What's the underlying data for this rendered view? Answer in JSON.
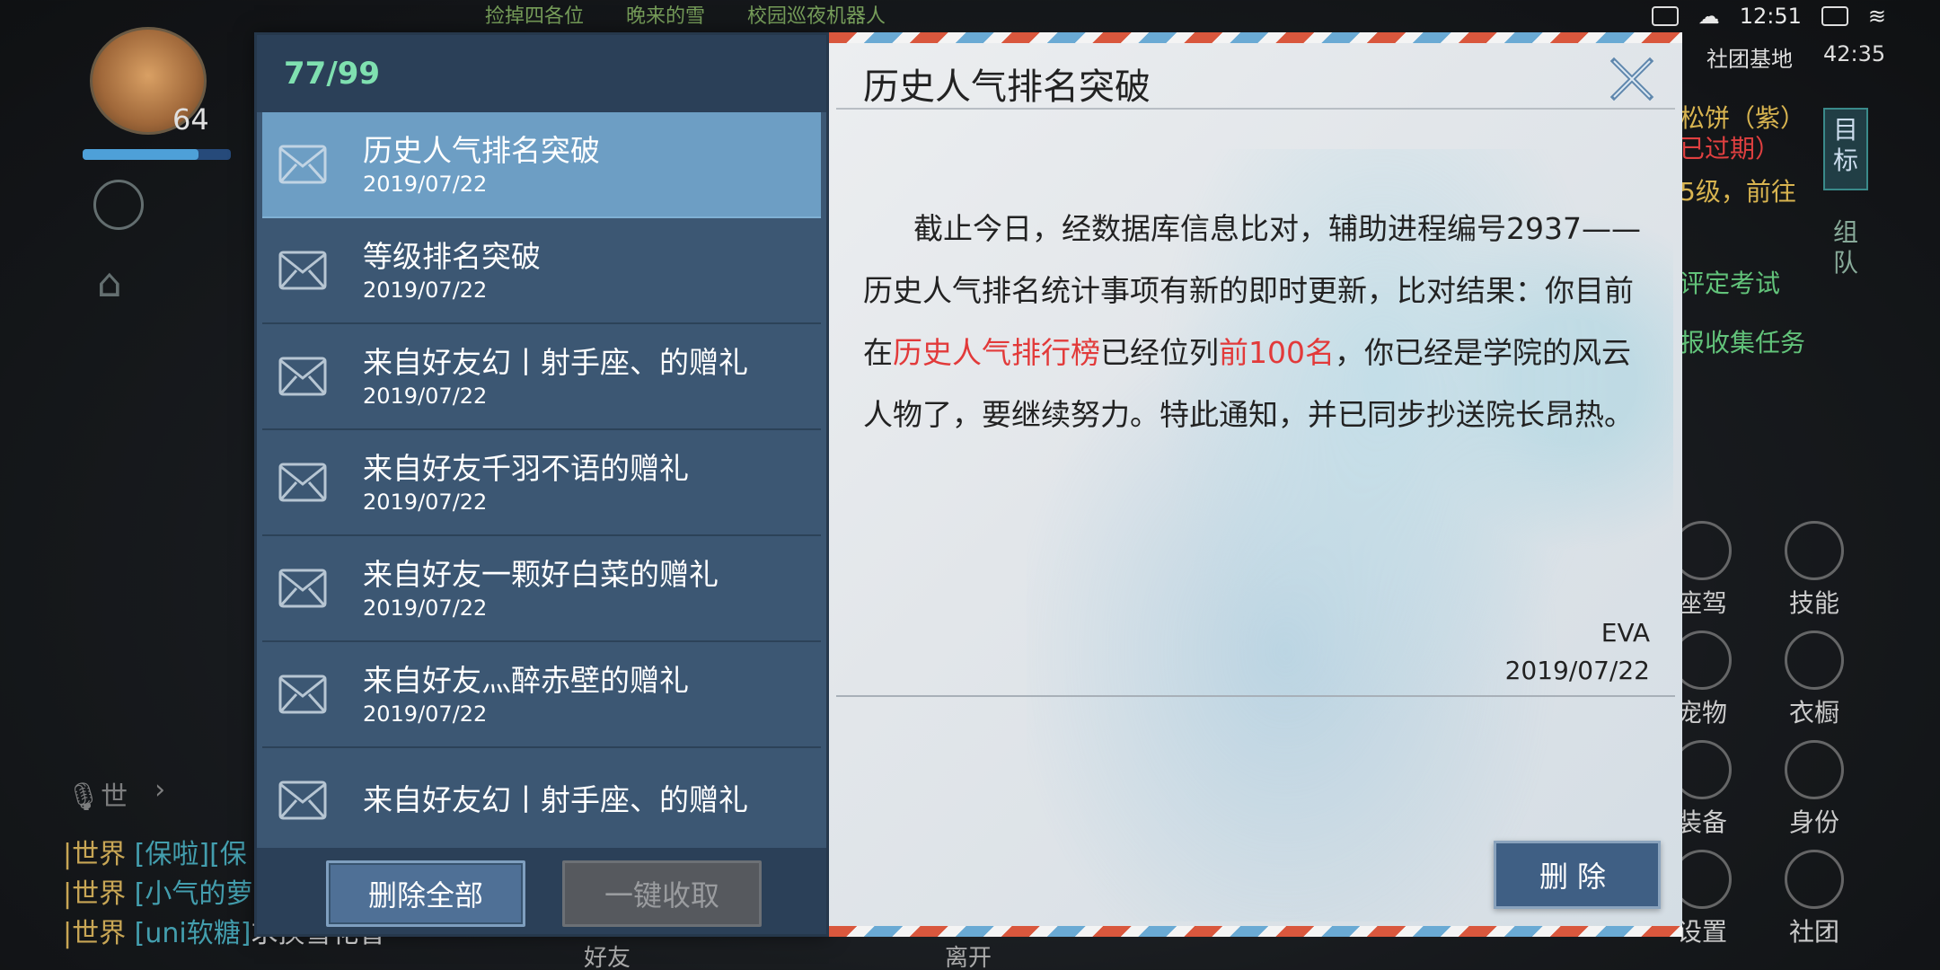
{
  "status_bar": {
    "time": "12:51"
  },
  "player": {
    "level": "64",
    "hp_fraction": 0.78
  },
  "hud": {
    "top_notices": [
      "捡掉四各位",
      "晚来的雪",
      "校园巡夜机器人"
    ],
    "right": {
      "timer": "42:35",
      "location": "社团基地",
      "quests": [
        "松饼（紫）",
        "已过期）",
        "5级，前往",
        "评定考试",
        "报收集任务"
      ],
      "tab_target": "目标",
      "tab_team": "组队",
      "buttons": [
        "座驾",
        "技能",
        "宠物",
        "衣橱",
        "装备",
        "身份",
        "设置",
        "社团"
      ]
    },
    "mic_label": "世",
    "chat": [
      {
        "channel": "|世界",
        "name": "[保啦]",
        "text": "[保"
      },
      {
        "channel": "|世界",
        "name": "[小气的萝",
        "text": ""
      },
      {
        "channel": "|世界",
        "name": "[uni软糖]",
        "text": "求换雪花香"
      }
    ],
    "bottom_labels": [
      "好友",
      "离开"
    ]
  },
  "mail": {
    "count": "77/99",
    "items": [
      {
        "title": "历史人气排名突破",
        "date": "2019/07/22",
        "active": true
      },
      {
        "title": "等级排名突破",
        "date": "2019/07/22"
      },
      {
        "title": "来自好友幻丨射手座、的赠礼",
        "date": "2019/07/22"
      },
      {
        "title": "来自好友千羽不语的赠礼",
        "date": "2019/07/22"
      },
      {
        "title": "来自好友一颗好白菜的赠礼",
        "date": "2019/07/22"
      },
      {
        "title": "来自好友灬醉赤壁的赠礼",
        "date": "2019/07/22"
      },
      {
        "title": "来自好友幻丨射手座、的赠礼",
        "date": ""
      }
    ],
    "delete_all_label": "删除全部",
    "collect_all_label": "一键收取",
    "detail": {
      "title": "历史人气排名突破",
      "body_1": "截止今日，经数据库信息比对，辅助进程编号2937——历史人气排名统计事项有新的即时更新，比对结果：你目前在",
      "body_hl1": "历史人气排行榜",
      "body_2": "已经位列",
      "body_hl2": "前100名",
      "body_3": "，你已经是学院的风云人物了，要继续努力。特此通知，并已同步抄送院长昂热。",
      "sender": "EVA",
      "date": "2019/07/22",
      "delete_label": "删除"
    }
  },
  "colors": {
    "list_panel": "#3c5773",
    "list_active": "#6d9ec4",
    "highlight_red": "#e23a3a",
    "count_green": "#7fe0b0"
  }
}
